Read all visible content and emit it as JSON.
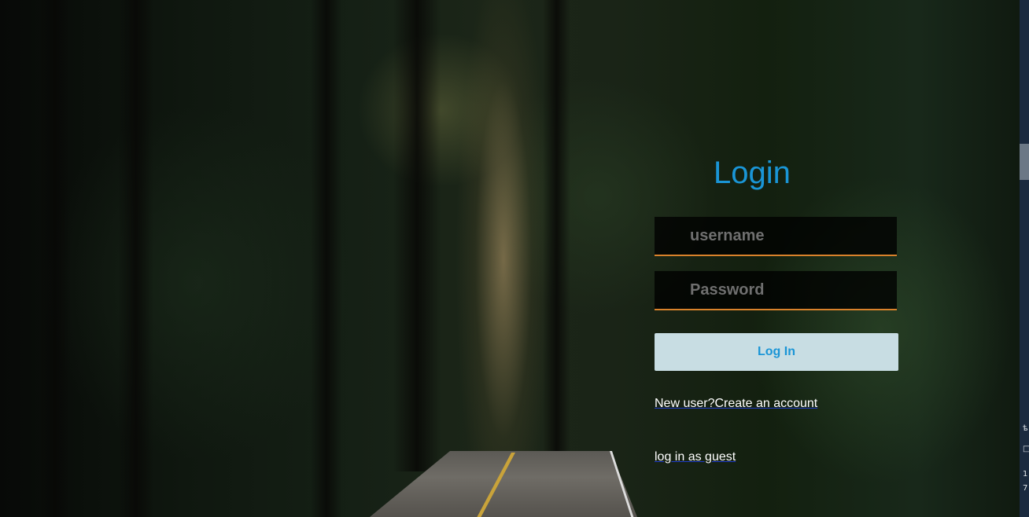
{
  "login": {
    "title": "Login",
    "username_placeholder": "username",
    "password_placeholder": "Password",
    "submit_label": "Log In",
    "create_account_link": "New user?Create an account",
    "guest_link": "log in as guest"
  },
  "edge": {
    "glyph_1": "ѣ",
    "glyph_2": "□",
    "glyph_3": "1",
    "glyph_4": "7"
  },
  "colors": {
    "title": "#1a95d6",
    "field_underline": "#d9822b",
    "button_bg": "#c8dde3",
    "button_text": "#1a95d6"
  }
}
